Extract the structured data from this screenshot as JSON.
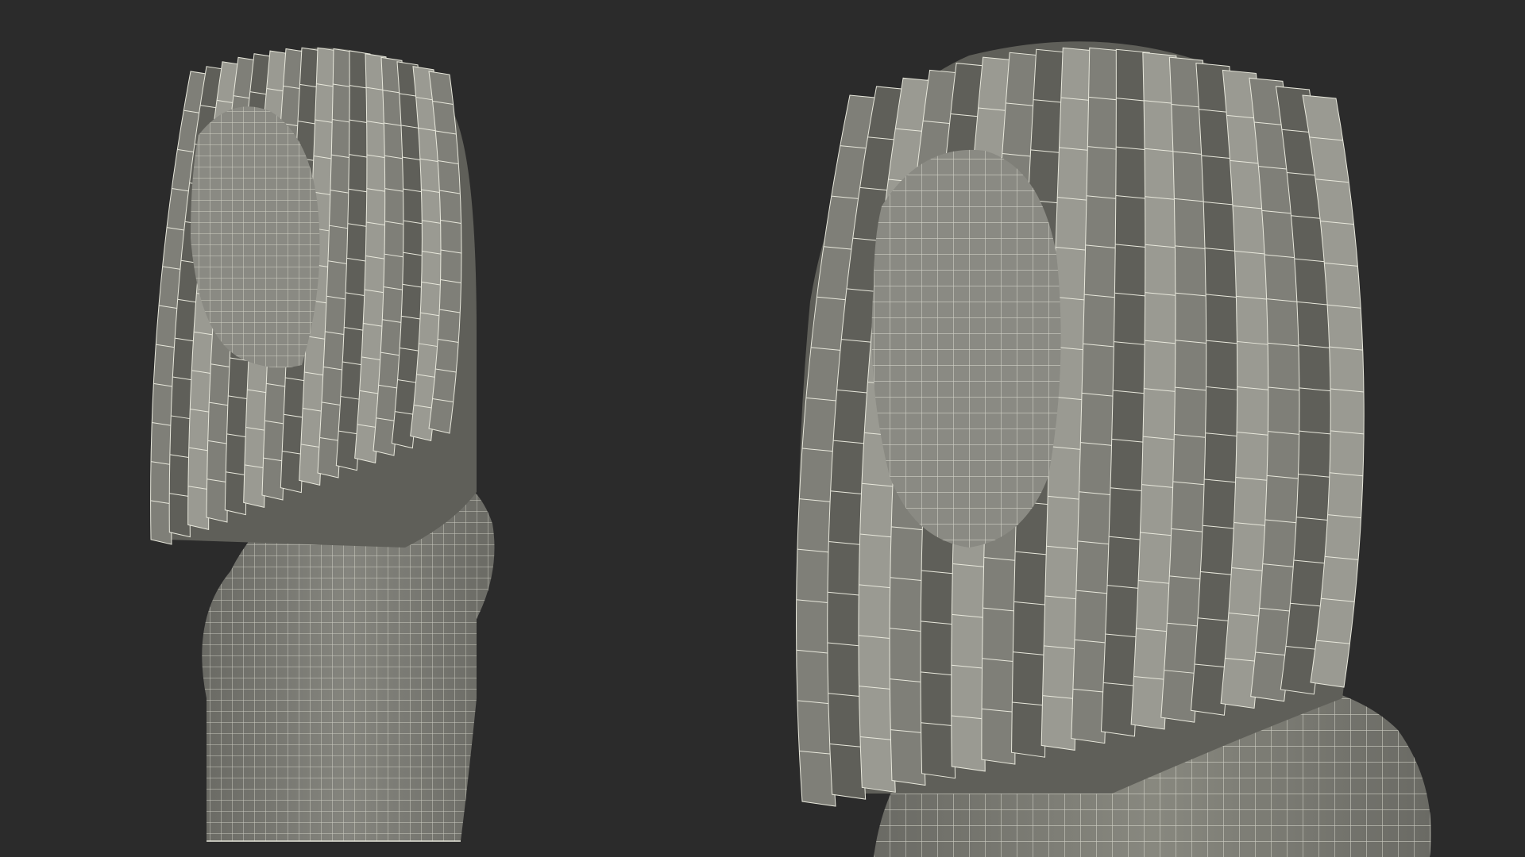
{
  "colors": {
    "background": "#2b2b2b",
    "mesh_fill": "#7f7f78",
    "mesh_fill_dark": "#5f5f59",
    "mesh_fill_light": "#9a9a92",
    "wire": "#e8e8dc",
    "shadow": "#1f1f1d"
  },
  "views": [
    {
      "name": "three-quarter-view",
      "subject": "bob-hairstyle-wireframe-on-bust"
    },
    {
      "name": "front-close-view",
      "subject": "bob-hairstyle-wireframe-on-bust"
    }
  ]
}
